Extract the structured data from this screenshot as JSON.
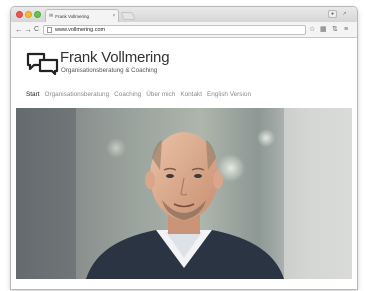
{
  "browser": {
    "tab_title": "Frank Vollmering",
    "tab_favicon": "✉",
    "tab_close": "×",
    "url": "www.vollmering.com",
    "nav_back": "←",
    "nav_forward": "→",
    "reload": "C",
    "star_icon": "☆",
    "menu_icon": "≡"
  },
  "site": {
    "name": "Frank Vollmering",
    "tagline": "Organisationsberatung & Coaching",
    "nav": [
      {
        "label": "Start",
        "active": true
      },
      {
        "label": "Organisationsberatung"
      },
      {
        "label": "Coaching"
      },
      {
        "label": "Über mich"
      },
      {
        "label": "Kontakt"
      },
      {
        "label": "English Version"
      }
    ]
  },
  "colors": {
    "nav_active": "#222222",
    "nav_inactive": "#8a8a8a",
    "text": "#333333"
  }
}
